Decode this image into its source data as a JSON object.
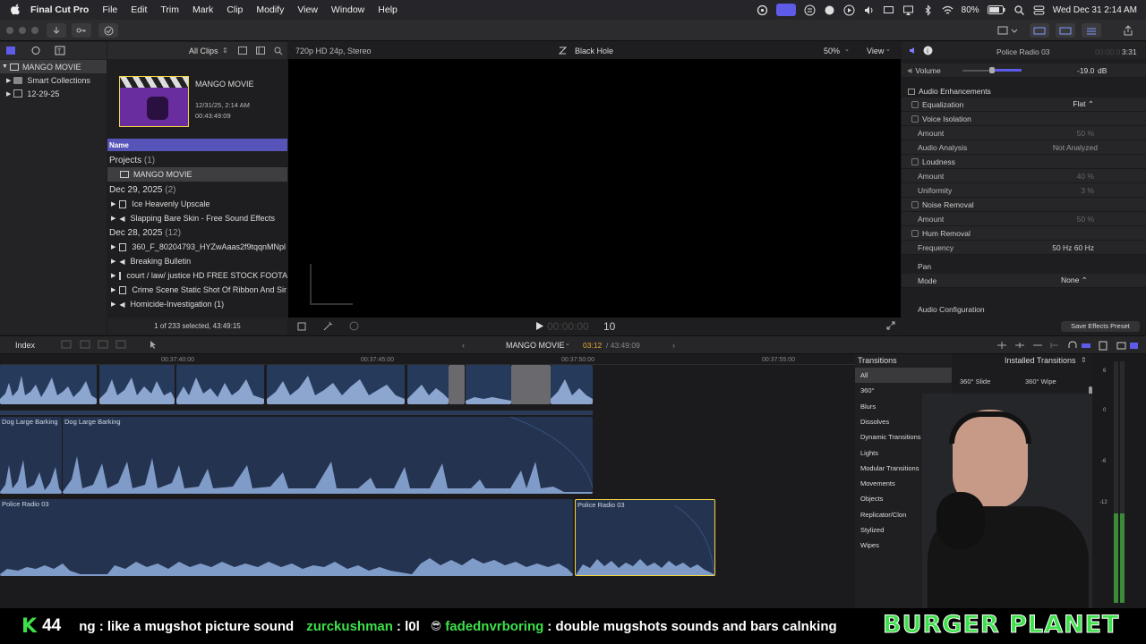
{
  "menubar": {
    "app_name": "Final Cut Pro",
    "items": [
      "File",
      "Edit",
      "Trim",
      "Mark",
      "Clip",
      "Modify",
      "View",
      "Window",
      "Help"
    ],
    "battery": "80%",
    "clock": "Wed Dec 31  2:14 AM"
  },
  "library": {
    "items": [
      {
        "label": "MANGO MOVIE",
        "selected": true
      },
      {
        "label": "Smart Collections",
        "selected": false
      },
      {
        "label": "12-29-25",
        "selected": false
      }
    ]
  },
  "browser": {
    "filter": "All Clips",
    "event": {
      "title": "MANGO MOVIE",
      "date": "12/31/25, 2:14 AM",
      "duration": "00:43:49:09"
    },
    "column_header": "Name",
    "groups": [
      {
        "header": "Projects",
        "count": "(1)",
        "rows": [
          {
            "label": "MANGO MOVIE",
            "selected": true,
            "icon": "project"
          }
        ]
      },
      {
        "header": "Dec 29, 2025",
        "count": "(2)",
        "rows": [
          {
            "label": "Ice Heavenly Upscale",
            "icon": "video"
          },
          {
            "label": "Slapping Bare Skin - Free Sound Effects",
            "icon": "audio"
          }
        ]
      },
      {
        "header": "Dec 28, 2025",
        "count": "(12)",
        "rows": [
          {
            "label": "360_F_80204793_HYZwAaas2f9tqqnMNpl",
            "icon": "image"
          },
          {
            "label": "Breaking Bulletin",
            "icon": "audio"
          },
          {
            "label": "court / law/ justice HD FREE STOCK FOOTA",
            "icon": "video"
          },
          {
            "label": "Crime Scene Static Shot Of Ribbon And Sir",
            "icon": "video"
          },
          {
            "label": "Homicide-Investigation (1)",
            "icon": "audio"
          }
        ]
      }
    ],
    "status": "1 of 233 selected, 43:49:15"
  },
  "viewer": {
    "format": "720p HD 24p, Stereo",
    "title": "Black Hole",
    "zoom": "50%",
    "view": "View",
    "timecode_prefix": "00:00:00",
    "timecode_frames": "10"
  },
  "inspector": {
    "clip_name": "Police Radio 03",
    "duration": "3:31",
    "duration_dim": "00:00:0",
    "volume_label": "Volume",
    "volume_value": "-19.0",
    "volume_unit": "dB",
    "section_enhancements": "Audio Enhancements",
    "rows": [
      {
        "label": "Equalization",
        "check": true,
        "value": "Flat ⌃",
        "value_color": "#ddd"
      },
      {
        "label": "Voice Isolation",
        "check": true,
        "value": "",
        "value_color": "#ddd"
      },
      {
        "label": "Amount",
        "check": false,
        "value": "50  %",
        "value_color": "#666"
      },
      {
        "label": "Audio Analysis",
        "check": false,
        "value": "Not Analyzed",
        "value_color": "#999"
      },
      {
        "label": "Loudness",
        "check": true,
        "value": "",
        "value_color": "#ddd"
      },
      {
        "label": "Amount",
        "check": false,
        "value": "40  %",
        "value_color": "#666"
      },
      {
        "label": "Uniformity",
        "check": false,
        "value": "3  %",
        "value_color": "#666"
      },
      {
        "label": "Noise Removal",
        "check": true,
        "value": "",
        "value_color": "#ddd"
      },
      {
        "label": "Amount",
        "check": false,
        "value": "50  %",
        "value_color": "#666"
      },
      {
        "label": "Hum Removal",
        "check": true,
        "value": "",
        "value_color": "#ddd"
      },
      {
        "label": "Frequency",
        "check": false,
        "value": "50 Hz     60 Hz",
        "value_color": "#ccc"
      }
    ],
    "pan_label": "Pan",
    "mode_label": "Mode",
    "mode_value": "None ⌃",
    "audio_config": "Audio Configuration",
    "save_preset": "Save Effects Preset"
  },
  "timeline_bar": {
    "index": "Index",
    "project": "MANGO MOVIE",
    "position": "03:12",
    "total": "/ 43:49:09"
  },
  "timeline": {
    "ruler": [
      "00:37:40:00",
      "00:37:45:00",
      "00:37:50:00",
      "00:37:55:00"
    ],
    "clips": {
      "a1": "Dog Large Barking",
      "a2": "Dog Large Barking",
      "b1": "Police Radio 03",
      "b2": "Police Radio 03"
    }
  },
  "transitions": {
    "title": "Transitions",
    "installed": "Installed Transitions",
    "categories": [
      "All",
      "360°",
      "Blurs",
      "Dissolves",
      "Dynamic Transitions",
      "Lights",
      "Modular Transitions",
      "Movements",
      "Objects",
      "Replicator/Clon",
      "Stylized",
      "Wipes"
    ],
    "thumbs": [
      "360° Slide",
      "360° Wipe"
    ]
  },
  "meters": {
    "scale": [
      "6",
      "0",
      "-6",
      "-12"
    ]
  },
  "chat": {
    "k_label": "K",
    "k_count": "44",
    "msg1_tail": "ng : like a mugshot picture sound",
    "user2": "zurckushman",
    "msg2": ": l0l",
    "user3": "fadednvrboring",
    "msg3": ": double mugshots sounds and bars calnking",
    "brand": "BURGER PLANET"
  },
  "colors": {
    "accent": "#5e5ce6",
    "selection_yellow": "#f5d742",
    "clip_blue": "#243350",
    "wave_blue": "#7f9cc8",
    "chat_green": "#3ee04b"
  }
}
